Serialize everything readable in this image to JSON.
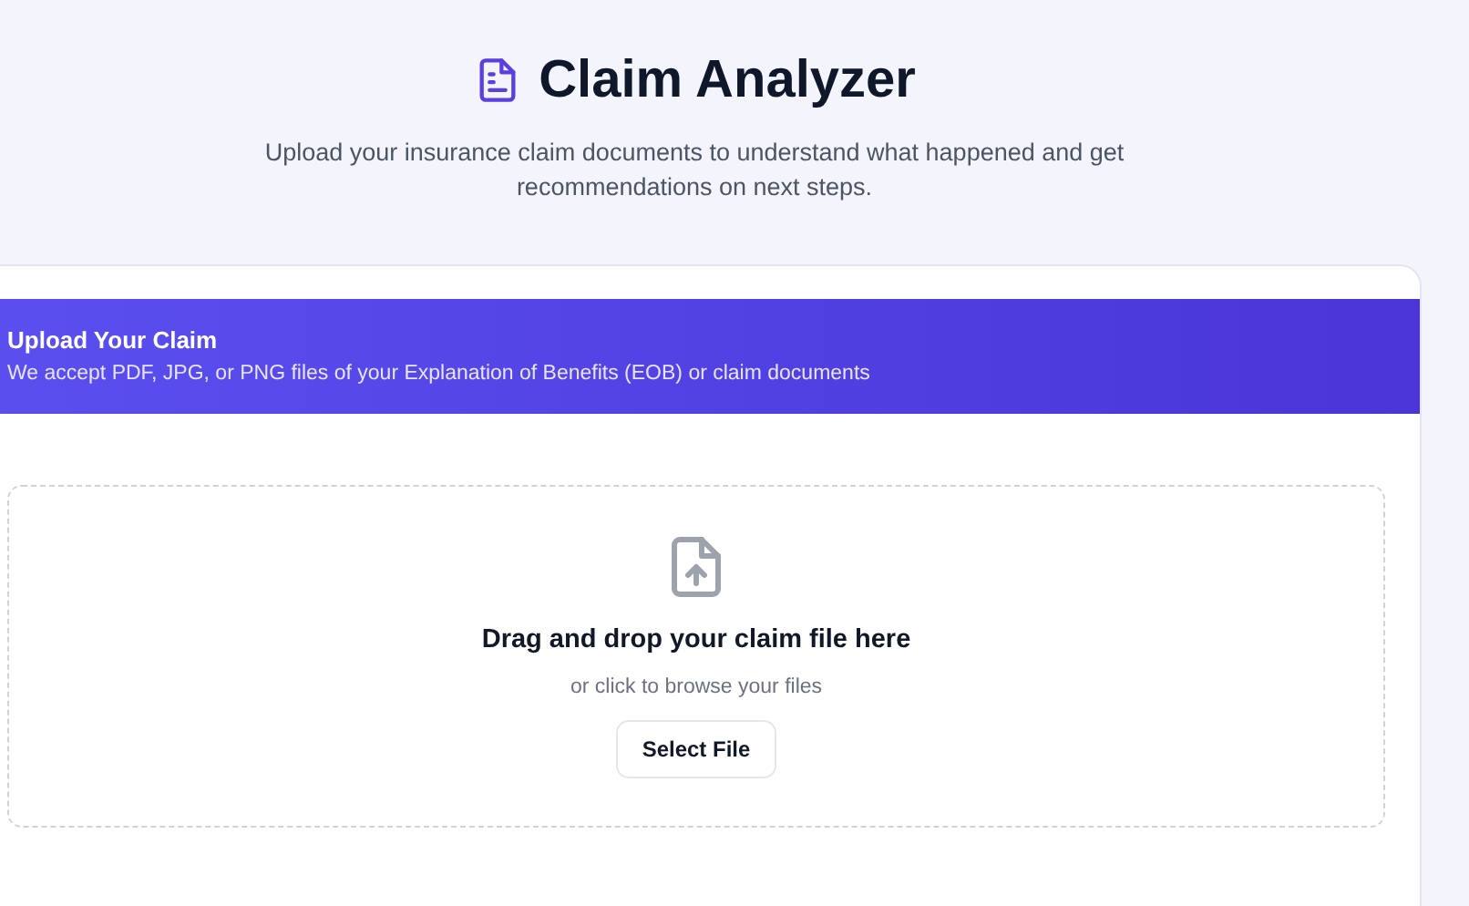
{
  "header": {
    "title": "Claim Analyzer",
    "subtitle": "Upload your insurance claim documents to understand what happened and get recommendations on next steps."
  },
  "upload_card": {
    "banner": {
      "title": "Upload Your Claim",
      "description": "We accept PDF, JPG, or PNG files of your Explanation of Benefits (EOB) or claim documents"
    },
    "dropzone": {
      "heading": "Drag and drop your claim file here",
      "hint": "or click to browse your files",
      "button": "Select File"
    }
  }
}
